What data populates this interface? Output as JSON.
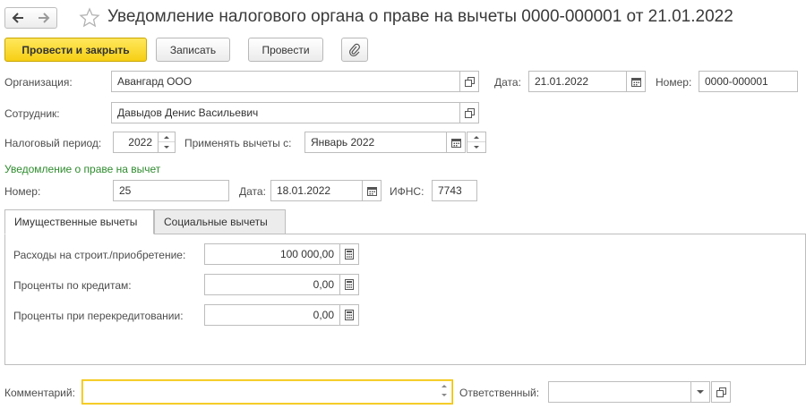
{
  "header": {
    "title": "Уведомление налогового органа о праве на вычеты 0000-000001 от 21.01.2022"
  },
  "toolbar": {
    "post_close_label": "Провести и закрыть",
    "save_label": "Записать",
    "post_label": "Провести"
  },
  "fields": {
    "organization_label": "Организация:",
    "organization_value": "Авангард ООО",
    "date_label": "Дата:",
    "date_value": "21.01.2022",
    "number_label": "Номер:",
    "number_value": "0000-000001",
    "employee_label": "Сотрудник:",
    "employee_value": "Давыдов Денис Васильевич",
    "tax_period_label": "Налоговый период:",
    "tax_period_value": "2022",
    "apply_from_label": "Применять вычеты с:",
    "apply_from_value": "Январь 2022"
  },
  "notice": {
    "section_title": "Уведомление о праве на вычет",
    "number_label": "Номер:",
    "number_value": "25",
    "date_label": "Дата:",
    "date_value": "18.01.2022",
    "ifns_label": "ИФНС:",
    "ifns_value": "7743"
  },
  "tabs": [
    {
      "label": "Имущественные вычеты",
      "active": true
    },
    {
      "label": "Социальные вычеты",
      "active": false
    }
  ],
  "property_tab": {
    "expenses_label": "Расходы на строит./приобретение:",
    "expenses_value": "100 000,00",
    "loan_interest_label": "Проценты по кредитам:",
    "loan_interest_value": "0,00",
    "refinance_interest_label": "Проценты при перекредитовании:",
    "refinance_interest_value": "0,00"
  },
  "footer": {
    "comment_label": "Комментарий:",
    "comment_value": "",
    "responsible_label": "Ответственный:",
    "responsible_value": ""
  },
  "colors": {
    "primary_button": "#f6cf14",
    "section_title": "#2e8b2e",
    "focus_border": "#f2c200"
  }
}
